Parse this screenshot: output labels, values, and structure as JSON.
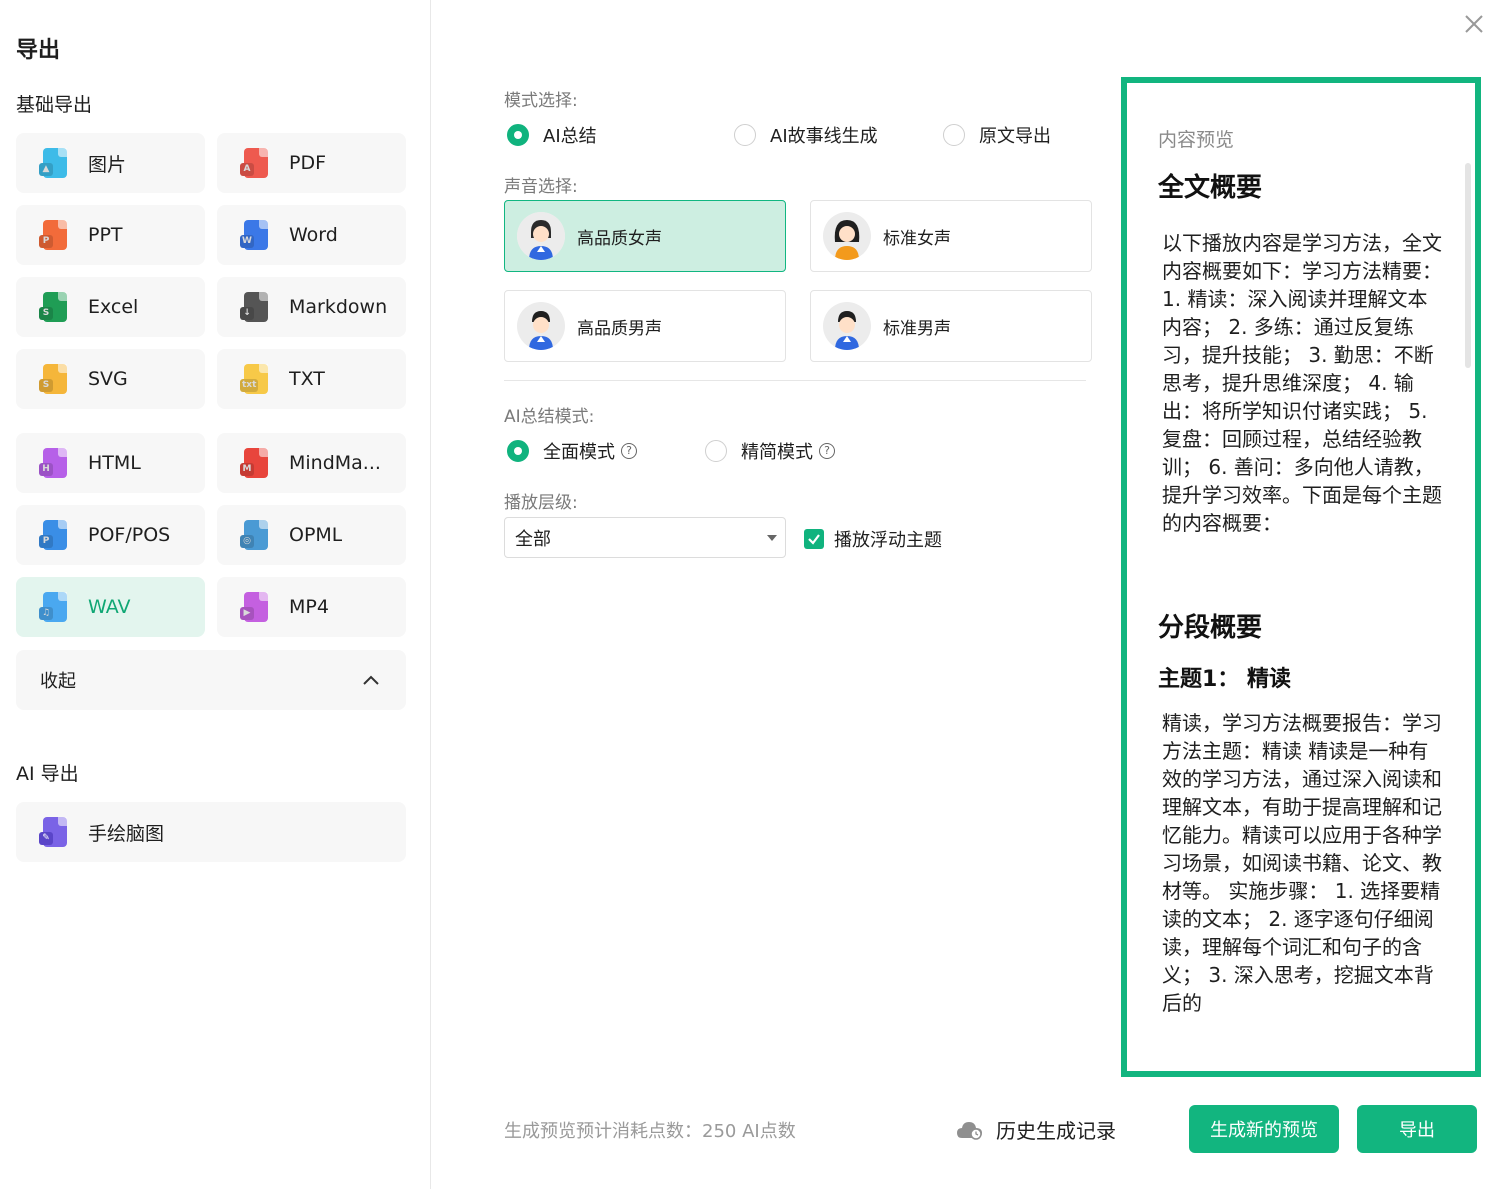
{
  "sidebar": {
    "title": "导出",
    "basic_title": "基础导出",
    "ai_title": "AI 导出",
    "collapse_label": "收起",
    "formats": [
      {
        "label": "图片",
        "icon": "image-file-icon",
        "color": "#3dbbe8",
        "mark": "▲"
      },
      {
        "label": "PDF",
        "icon": "pdf-file-icon",
        "color": "#ee5a4f",
        "mark": "A"
      },
      {
        "label": "PPT",
        "icon": "ppt-file-icon",
        "color": "#f26b3a",
        "mark": "P"
      },
      {
        "label": "Word",
        "icon": "word-file-icon",
        "color": "#3b78e7",
        "mark": "W"
      },
      {
        "label": "Excel",
        "icon": "excel-file-icon",
        "color": "#1f9d55",
        "mark": "S"
      },
      {
        "label": "Markdown",
        "icon": "markdown-file-icon",
        "color": "#555555",
        "mark": "↓"
      },
      {
        "label": "SVG",
        "icon": "svg-file-icon",
        "color": "#f5b63a",
        "mark": "S"
      },
      {
        "label": "TXT",
        "icon": "txt-file-icon",
        "color": "#f7c948",
        "mark": "txt"
      },
      {
        "label": "HTML",
        "icon": "html-file-icon",
        "color": "#b660e8",
        "mark": "H"
      },
      {
        "label": "MindMa...",
        "icon": "mindmanager-file-icon",
        "color": "#e8453c",
        "mark": "M"
      },
      {
        "label": "POF/POS",
        "icon": "pof-file-icon",
        "color": "#3a8ee6",
        "mark": "P"
      },
      {
        "label": "OPML",
        "icon": "opml-file-icon",
        "color": "#4a9ad4",
        "mark": "◎"
      },
      {
        "label": "WAV",
        "icon": "wav-file-icon",
        "color": "#4aa8f0",
        "mark": "♫"
      },
      {
        "label": "MP4",
        "icon": "mp4-file-icon",
        "color": "#c460e0",
        "mark": "▶"
      }
    ],
    "active_format": "WAV",
    "ai_items": [
      {
        "label": "手绘脑图",
        "icon": "handdrawn-mindmap-icon",
        "color": "#7a63e6",
        "mark": "✎"
      }
    ]
  },
  "form": {
    "mode_label": "模式选择:",
    "modes": [
      "AI总结",
      "AI故事线生成",
      "原文导出"
    ],
    "mode_selected": "AI总结",
    "voice_label": "声音选择:",
    "voices": [
      "高品质女声",
      "标准女声",
      "高品质男声",
      "标准男声"
    ],
    "voice_selected": "高品质女声",
    "summary_mode_label": "AI总结模式:",
    "summary_modes": [
      "全面模式",
      "精简模式"
    ],
    "summary_selected": "全面模式",
    "level_label": "播放层级:",
    "level_value": "全部",
    "float_topic_label": "播放浮动主题",
    "float_topic_checked": true
  },
  "preview": {
    "label": "内容预览",
    "h1": "全文概要",
    "overview_text": "以下播放内容是学习方法，全文内容概要如下：学习方法精要： 1. 精读：深入阅读并理解文本内容； 2. 多练：通过反复练习，提升技能； 3. 勤思：不断思考，提升思维深度； 4. 输出：将所学知识付诸实践； 5. 复盘：回顾过程，总结经验教训； 6. 善问：多向他人请教，提升学习效率。下面是每个主题的内容概要：",
    "section_title": "分段概要",
    "topic_title": "主题1： 精读",
    "topic_text": "精读，学习方法概要报告：学习方法主题：精读 精读是一种有效的学习方法，通过深入阅读和理解文本，有助于提高理解和记忆能力。精读可以应用于各种学习场景，如阅读书籍、论文、教材等。 实施步骤： 1. 选择要精读的文本； 2. 逐字逐句仔细阅读，理解每个词汇和句子的含义； 3. 深入思考，挖掘文本背后的"
  },
  "footer": {
    "cost_text": "生成预览预计消耗点数：250 AI点数",
    "history_label": "历史生成记录",
    "regen_label": "生成新的预览",
    "export_label": "导出"
  },
  "colors": {
    "accent": "#12b57f",
    "active_bg": "#e3f5ee",
    "selected_card_bg": "#cdeee1"
  }
}
